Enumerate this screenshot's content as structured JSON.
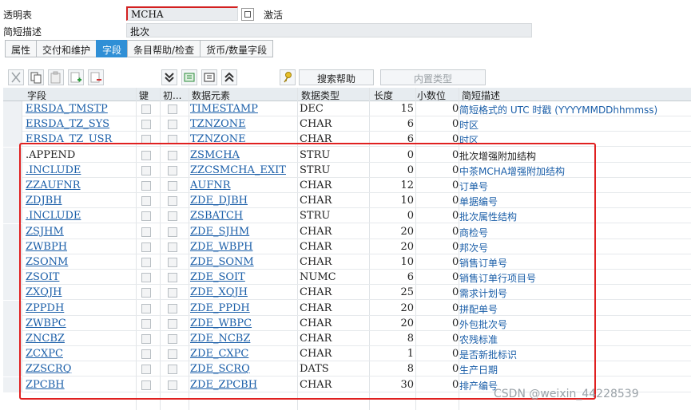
{
  "header": {
    "table_label": "透明表",
    "table_value": "MCHA",
    "status": "激活",
    "desc_label": "简短描述",
    "desc_value": "批次"
  },
  "tabs": [
    {
      "label": "属性"
    },
    {
      "label": "交付和维护"
    },
    {
      "label": "字段"
    },
    {
      "label": "条目帮助/检查"
    },
    {
      "label": "货币/数量字段"
    }
  ],
  "toolbar": {
    "search_help": "搜索帮助",
    "builtin_type": "内置类型"
  },
  "columns": {
    "field": "字段",
    "key": "键",
    "init": "初...",
    "element": "数据元素",
    "type": "数据类型",
    "length": "长度",
    "decimals": "小数位",
    "desc": "简短描述"
  },
  "rows": [
    {
      "field": "ERSDA_TMSTP",
      "element": "TIMESTAMP",
      "type": "DEC",
      "length": "15",
      "dec": "0",
      "desc": "简短格式的 UTC 时戳 (YYYYMMDDhhmmss)",
      "append": false
    },
    {
      "field": "ERSDA_TZ_SYS",
      "element": "TZNZONE",
      "type": "CHAR",
      "length": "6",
      "dec": "0",
      "desc": "时区",
      "append": false
    },
    {
      "field": "ERSDA_TZ_USR",
      "element": "TZNZONE",
      "type": "CHAR",
      "length": "6",
      "dec": "0",
      "desc": "时区",
      "append": false
    },
    {
      "field": ".APPEND",
      "element": "ZSMCHA",
      "type": "STRU",
      "length": "0",
      "dec": "0",
      "desc": "批次增强附加结构",
      "append": true
    },
    {
      "field": ".INCLUDE",
      "element": "ZZCSMCHA_EXIT",
      "type": "STRU",
      "length": "0",
      "dec": "0",
      "desc": "中茶MCHA增强附加结构",
      "append": false
    },
    {
      "field": "ZZAUFNR",
      "element": "AUFNR",
      "type": "CHAR",
      "length": "12",
      "dec": "0",
      "desc": "订单号",
      "append": false
    },
    {
      "field": "ZDJBH",
      "element": "ZDE_DJBH",
      "type": "CHAR",
      "length": "10",
      "dec": "0",
      "desc": "单据编号",
      "append": false
    },
    {
      "field": ".INCLUDE",
      "element": "ZSBATCH",
      "type": "STRU",
      "length": "0",
      "dec": "0",
      "desc": "批次属性结构",
      "append": false
    },
    {
      "field": "ZSJHM",
      "element": "ZDE_SJHM",
      "type": "CHAR",
      "length": "20",
      "dec": "0",
      "desc": "商检号",
      "append": false
    },
    {
      "field": "ZWBPH",
      "element": "ZDE_WBPH",
      "type": "CHAR",
      "length": "20",
      "dec": "0",
      "desc": "邦次号",
      "append": false
    },
    {
      "field": "ZSONM",
      "element": "ZDE_SONM",
      "type": "CHAR",
      "length": "10",
      "dec": "0",
      "desc": "销售订单号",
      "append": false
    },
    {
      "field": "ZSOIT",
      "element": "ZDE_SOIT",
      "type": "NUMC",
      "length": "6",
      "dec": "0",
      "desc": "销售订单行项目号",
      "append": false
    },
    {
      "field": "ZXQJH",
      "element": "ZDE_XQJH",
      "type": "CHAR",
      "length": "25",
      "dec": "0",
      "desc": "需求计划号",
      "append": false
    },
    {
      "field": "ZPPDH",
      "element": "ZDE_PPDH",
      "type": "CHAR",
      "length": "20",
      "dec": "0",
      "desc": "拼配单号",
      "append": false
    },
    {
      "field": "ZWBPC",
      "element": "ZDE_WBPC",
      "type": "CHAR",
      "length": "20",
      "dec": "0",
      "desc": "外包批次号",
      "append": false
    },
    {
      "field": "ZNCBZ",
      "element": "ZDE_NCBZ",
      "type": "CHAR",
      "length": "8",
      "dec": "0",
      "desc": "农残标准",
      "append": false
    },
    {
      "field": "ZCXPC",
      "element": "ZDE_CXPC",
      "type": "CHAR",
      "length": "1",
      "dec": "0",
      "desc": "是否新批标识",
      "append": false
    },
    {
      "field": "ZZSCRQ",
      "element": "ZDE_SCRQ",
      "type": "DATS",
      "length": "8",
      "dec": "0",
      "desc": "生产日期",
      "append": false
    },
    {
      "field": "ZPCBH",
      "element": "ZDE_ZPCBH",
      "type": "CHAR",
      "length": "30",
      "dec": "0",
      "desc": "排产编号",
      "append": false
    }
  ],
  "watermark": "CSDN @weixin_44228539",
  "colors": {
    "accent": "#2f8fd6",
    "highlight_box": "#e02020",
    "link": "#1a5ea8"
  }
}
